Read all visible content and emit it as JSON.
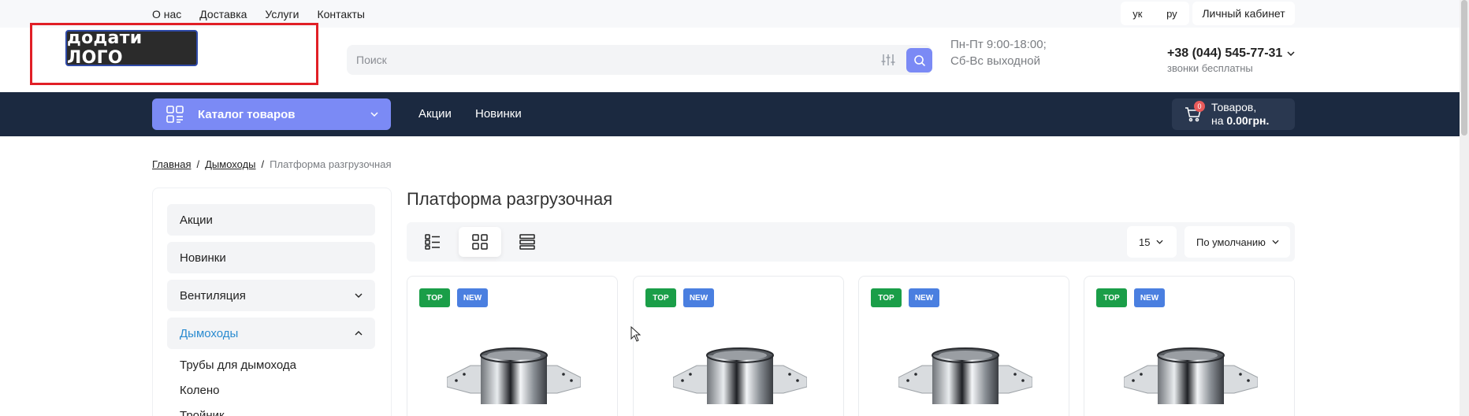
{
  "topbar": {
    "links": [
      "О нас",
      "Доставка",
      "Услуги",
      "Контакты"
    ],
    "langs": [
      "ук",
      "ру"
    ],
    "cabinet": "Личный кабинет"
  },
  "header": {
    "logo_text": "додати ЛОГО",
    "search_placeholder": "Поиск",
    "hours_line1": "Пн-Пт 9:00-18:00;",
    "hours_line2": "Сб-Вс выходной",
    "phone": "+38 (044) 545-77-31",
    "phone_sub": "звонки бесплатны"
  },
  "nav": {
    "catalog": "Каталог товаров",
    "links": [
      "Акции",
      "Новинки"
    ],
    "cart_count": "0",
    "cart_line1": "Товаров,",
    "cart_prefix": "на ",
    "cart_total": "0.00грн."
  },
  "breadcrumb": {
    "home": "Главная",
    "section": "Дымоходы",
    "separator": "/",
    "current": "Платформа разгрузочная"
  },
  "sidebar": {
    "items": [
      "Акции",
      "Новинки",
      "Вентиляция",
      "Дымоходы"
    ],
    "subitems": [
      "Трубы для дымохода",
      "Колено",
      "Тройник"
    ]
  },
  "main": {
    "title": "Платформа разгрузочная",
    "per_page": "15",
    "sort": "По умолчанию"
  },
  "products": [
    {
      "tags": [
        "TOP",
        "NEW"
      ]
    },
    {
      "tags": [
        "TOP",
        "NEW"
      ]
    },
    {
      "tags": [
        "TOP",
        "NEW"
      ]
    },
    {
      "tags": [
        "TOP",
        "NEW"
      ]
    }
  ],
  "colors": {
    "accent": "#7b8af5",
    "navbar": "#1b2940",
    "tag_top": "#1a9e48",
    "tag_new": "#4a7fe0",
    "active_link": "#2a8bd0"
  }
}
